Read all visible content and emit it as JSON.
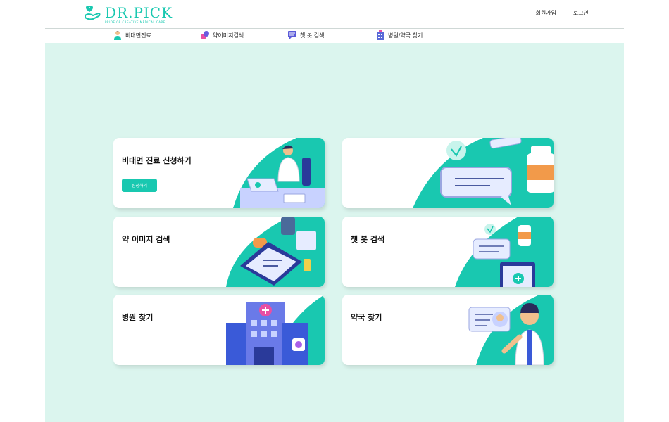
{
  "brand": {
    "name": "DR.PICK",
    "tagline": "PRIDE OF CREATIVE MEDICAL CARE"
  },
  "header_links": {
    "signup": "회원가입",
    "login": "로그인"
  },
  "nav": [
    {
      "label": "비대면진료",
      "icon": "doctor-icon"
    },
    {
      "label": "약이미지검색",
      "icon": "pill-icon"
    },
    {
      "label": "챗 봇 검색",
      "icon": "chat-icon"
    },
    {
      "label": "병원/약국 찾기",
      "icon": "building-icon"
    }
  ],
  "cards": [
    {
      "title": "비대면 진료 신청하기",
      "button": "신청하기"
    },
    {
      "title": ""
    },
    {
      "title": "약 이미지 검색"
    },
    {
      "title": "챗 봇 검색"
    },
    {
      "title": "병원 찾기"
    },
    {
      "title": "약국 찾기"
    }
  ],
  "colors": {
    "accent": "#19c8b0",
    "background": "#dbf5ee"
  }
}
